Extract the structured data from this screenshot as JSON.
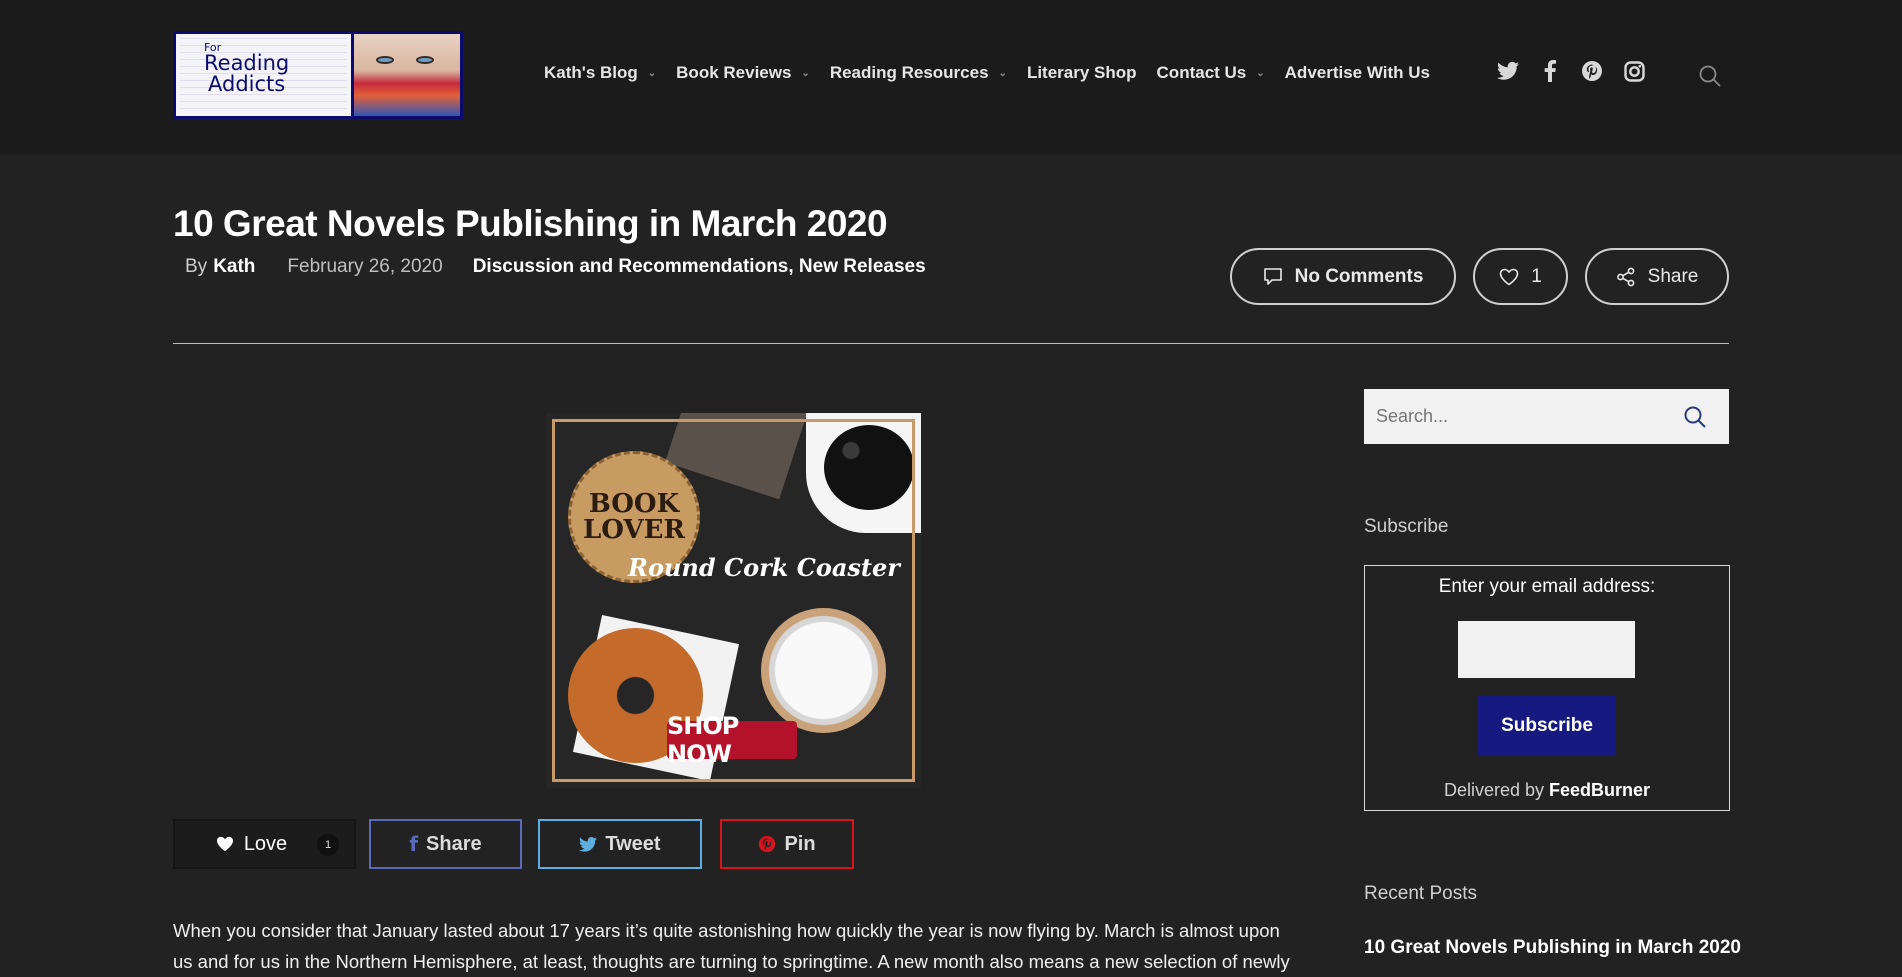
{
  "header": {
    "logo": {
      "line1": "For",
      "line2": "Reading",
      "line3": "Addicts"
    },
    "nav": [
      {
        "label": "Kath's Blog",
        "has_dropdown": true
      },
      {
        "label": "Book Reviews",
        "has_dropdown": true
      },
      {
        "label": "Reading Resources",
        "has_dropdown": true
      },
      {
        "label": "Literary Shop",
        "has_dropdown": false
      },
      {
        "label": "Contact Us",
        "has_dropdown": true
      },
      {
        "label": "Advertise With Us",
        "has_dropdown": false
      }
    ],
    "social_icons": [
      "twitter-icon",
      "facebook-icon",
      "pinterest-icon",
      "instagram-icon"
    ],
    "search_icon": "search-icon"
  },
  "post": {
    "title": "10 Great Novels Publishing in March 2020",
    "by_label": "By",
    "author": "Kath",
    "date": "February 26, 2020",
    "categories": "Discussion and Recommendations, New Releases",
    "comments_label": "No Comments",
    "likes_count": "1",
    "share_label": "Share",
    "body_line1": "When you consider that January lasted about 17 years it’s quite astonishing how quickly the year is now flying by. March is almost upon",
    "body_line2": "us and for us in the Northern Hemisphere, at least, thoughts are turning to springtime. A new month also means a new selection of newly"
  },
  "ad": {
    "coaster_line1": "BOOK",
    "coaster_line2": "LOVER",
    "title": "Round Cork Coaster",
    "cta": "SHOP NOW"
  },
  "share_bar": {
    "love_label": "Love",
    "love_count": "1",
    "facebook_label": "Share",
    "twitter_label": "Tweet",
    "pinterest_label": "Pin"
  },
  "sidebar": {
    "search_placeholder": "Search...",
    "subscribe_heading": "Subscribe",
    "subscribe_prompt": "Enter your email address:",
    "subscribe_button": "Subscribe",
    "delivered_by": "Delivered by",
    "delivered_brand": "FeedBurner",
    "recent_heading": "Recent Posts",
    "recent_posts": [
      "10 Great Novels Publishing in March 2020"
    ]
  },
  "colors": {
    "background": "#222222",
    "header_bg": "#1b1b1b",
    "subscribe_button": "#161a80",
    "facebook": "#5a69b8",
    "twitter": "#5faee0",
    "pinterest": "#d4151d"
  }
}
